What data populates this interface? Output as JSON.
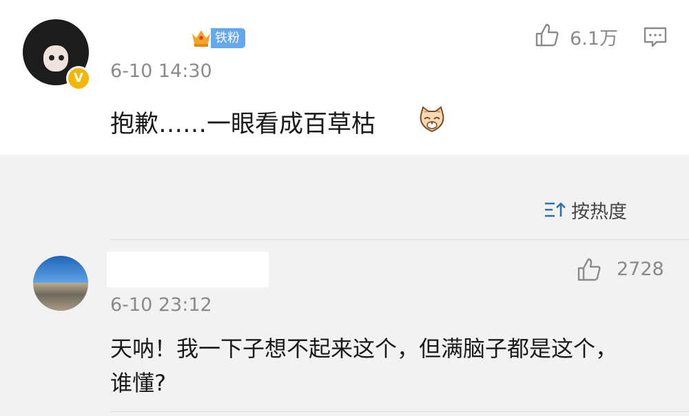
{
  "post": {
    "badge_label": "铁粉",
    "verified_mark": "V",
    "date": "6-10 14:30",
    "likes": "6.1万",
    "text": "抱歉……一眼看成百草枯",
    "icons": {
      "like": "thumbs-up-icon",
      "comment": "comment-icon",
      "emoji": "cat-emoji-icon",
      "crown": "crown-icon"
    }
  },
  "sort": {
    "label": "按热度",
    "icon": "sort-icon"
  },
  "reply": {
    "date": "6-10 23:12",
    "likes": "2728",
    "text": "天呐！我一下子想不起来这个，但满脑子都是这个，谁懂?"
  },
  "colors": {
    "accent_blue": "#63a9ee",
    "verified_yellow": "#f2b705",
    "gray_text": "#8a8a8a"
  }
}
